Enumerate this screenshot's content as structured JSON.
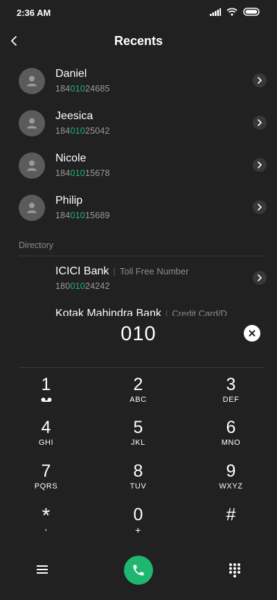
{
  "status_bar": {
    "time": "2:36 AM"
  },
  "header": {
    "title": "Recents"
  },
  "recents": [
    {
      "name": "Daniel",
      "prefix": "184",
      "match": "010",
      "suffix": "24685"
    },
    {
      "name": "Jeesica",
      "prefix": "184",
      "match": "010",
      "suffix": "25042"
    },
    {
      "name": "Nicole",
      "prefix": "184",
      "match": "010",
      "suffix": "15678"
    },
    {
      "name": "Philip",
      "prefix": "184",
      "match": "010",
      "suffix": "15689"
    }
  ],
  "directory": {
    "label": "Directory",
    "items": [
      {
        "name": "ICICI Bank",
        "tag": "Toll Free Number",
        "prefix": "180",
        "match": "010",
        "suffix": "24242"
      },
      {
        "name": "Kotak Mahindra Bank",
        "tag": "Credit Card/D"
      }
    ]
  },
  "dialer": {
    "input": "010"
  },
  "keypad": [
    {
      "digit": "1",
      "letters": ""
    },
    {
      "digit": "2",
      "letters": "ABC"
    },
    {
      "digit": "3",
      "letters": "DEF"
    },
    {
      "digit": "4",
      "letters": "GHI"
    },
    {
      "digit": "5",
      "letters": "JKL"
    },
    {
      "digit": "6",
      "letters": "MNO"
    },
    {
      "digit": "7",
      "letters": "PQRS"
    },
    {
      "digit": "8",
      "letters": "TUV"
    },
    {
      "digit": "9",
      "letters": "WXYZ"
    },
    {
      "digit": "*",
      "letters": ","
    },
    {
      "digit": "0",
      "letters": "+"
    },
    {
      "digit": "#",
      "letters": ""
    }
  ],
  "colors": {
    "background": "#212121",
    "highlight": "#23b26b",
    "call": "#1fb670"
  },
  "icons": {
    "back": "chevron-left-icon",
    "signal": "signal-icon",
    "wifi": "wifi-icon",
    "battery": "battery-icon",
    "avatar": "person-icon",
    "row_action": "chevron-right-icon",
    "clear": "close-icon",
    "voicemail": "voicemail-icon",
    "menu": "menu-icon",
    "call": "phone-icon",
    "dialpad": "dialpad-icon"
  }
}
